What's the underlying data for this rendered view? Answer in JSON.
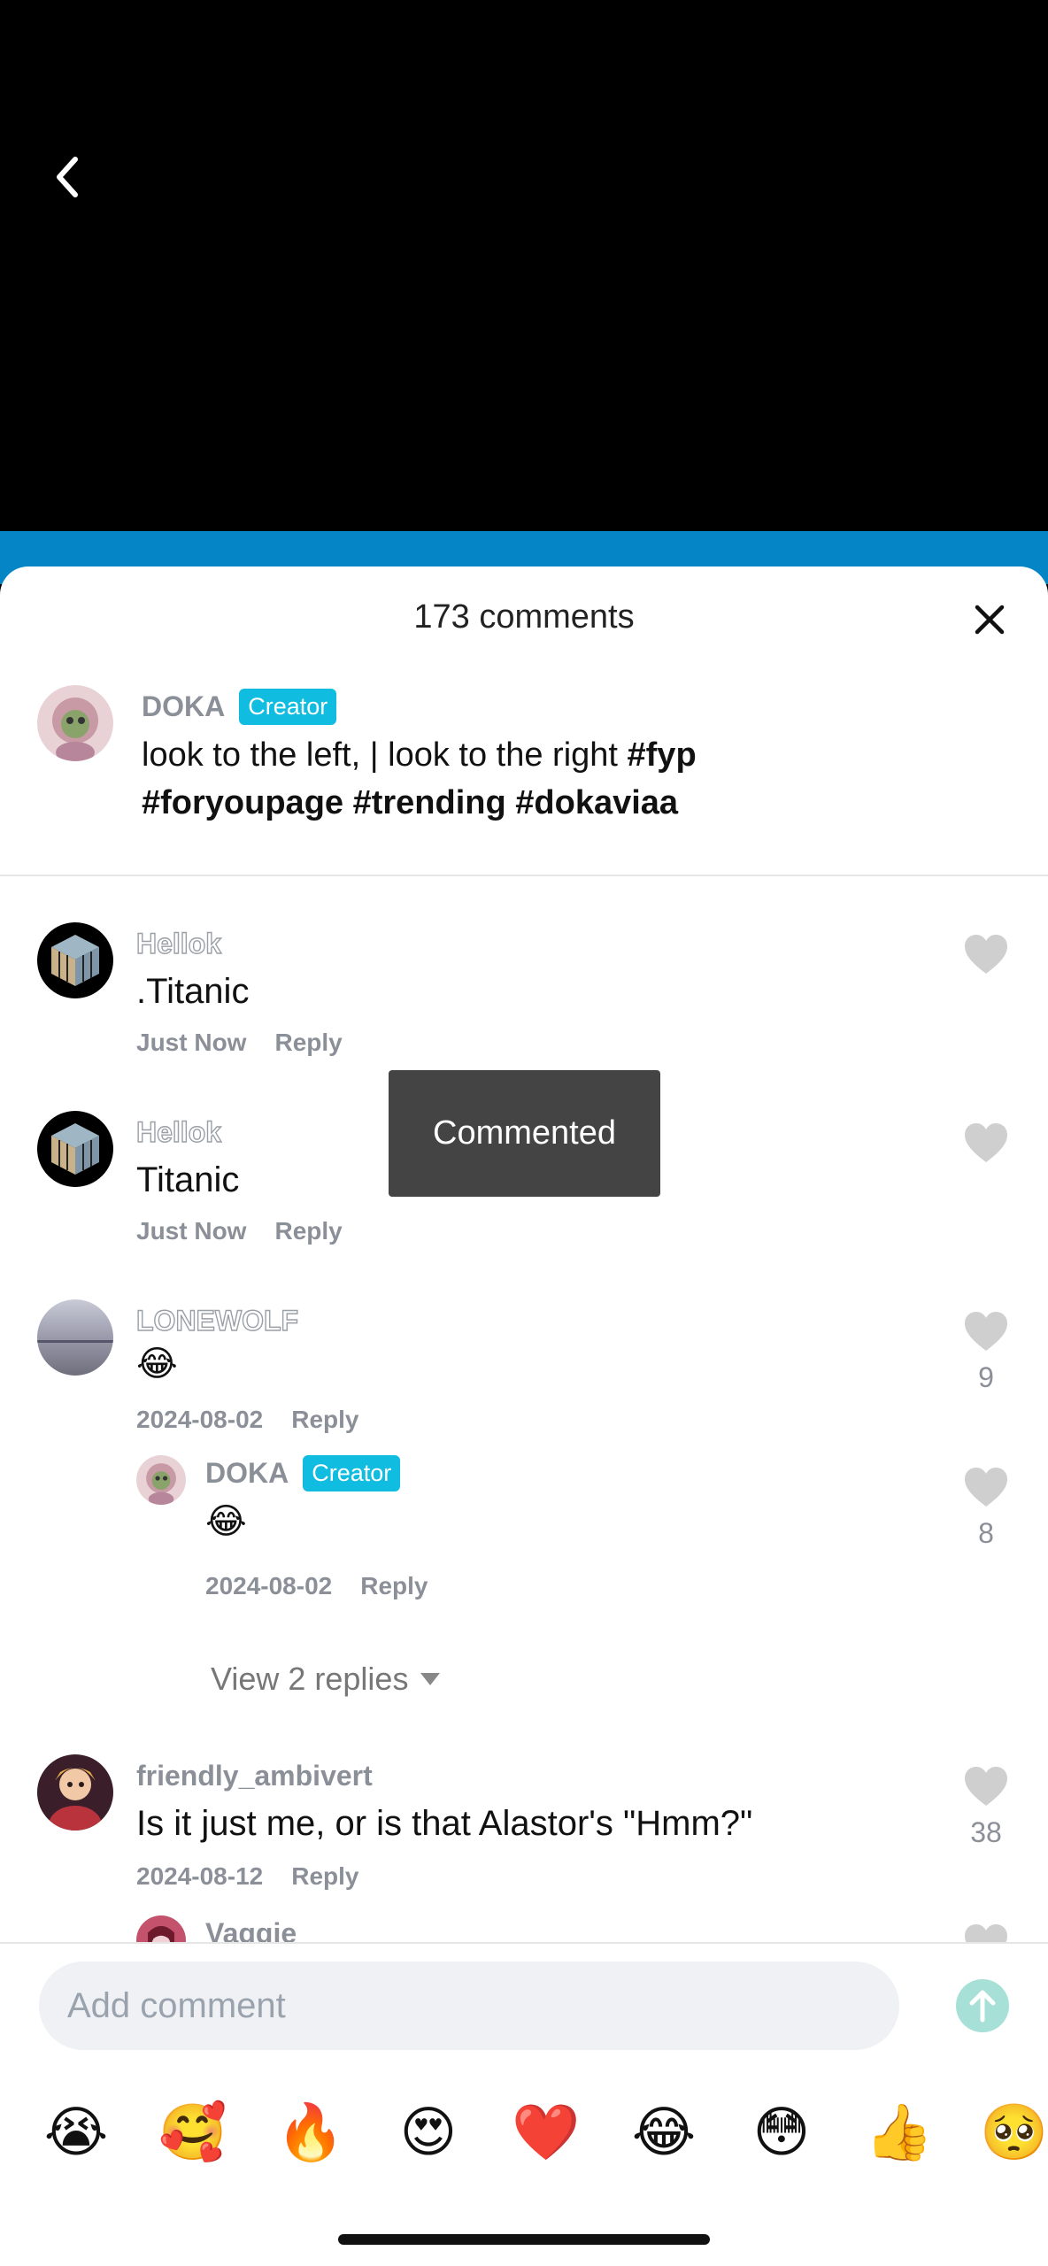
{
  "header": {
    "comment_count": "173 comments",
    "back_icon": "chevron-left-icon",
    "close_icon": "close-icon"
  },
  "caption": {
    "author": "DOKA",
    "badge": "Creator",
    "text_plain": "look to the left,  | look to the right ",
    "hashtag1": "#fyp",
    "hashtag2": "#foryoupage #trending #dokaviaa"
  },
  "comments": [
    {
      "user": "Hellok",
      "text": ".Titanic",
      "time": "Just Now",
      "reply": "Reply"
    },
    {
      "user": "Hellok",
      "text": "Titanic",
      "time": "Just Now",
      "reply": "Reply"
    },
    {
      "user": "LONEWOLF",
      "text": "😂",
      "time": "2024-08-02",
      "reply": "Reply",
      "likes": "9"
    },
    {
      "user": "DOKA",
      "badge": "Creator",
      "text": "😂",
      "time": "2024-08-02",
      "reply": "Reply",
      "likes": "8"
    },
    {
      "user": "friendly_ambivert",
      "text": "Is it just me, or is that Alastor's \"Hmm?\"",
      "time": "2024-08-12",
      "reply": "Reply",
      "likes": "38"
    },
    {
      "user": "Vaggie"
    }
  ],
  "view_replies": "View 2 replies",
  "toast": "Commented",
  "composer": {
    "placeholder": "Add comment",
    "send_icon": "arrow-up-icon"
  },
  "emojis": [
    "😭",
    "🥰",
    "🔥",
    "😍",
    "❤️",
    "😂",
    "😳",
    "👍",
    "🥺"
  ],
  "colors": {
    "creator_badge": "#10bde0",
    "send_button": "#a6e0d6",
    "blue_strip": "#0685c6"
  }
}
